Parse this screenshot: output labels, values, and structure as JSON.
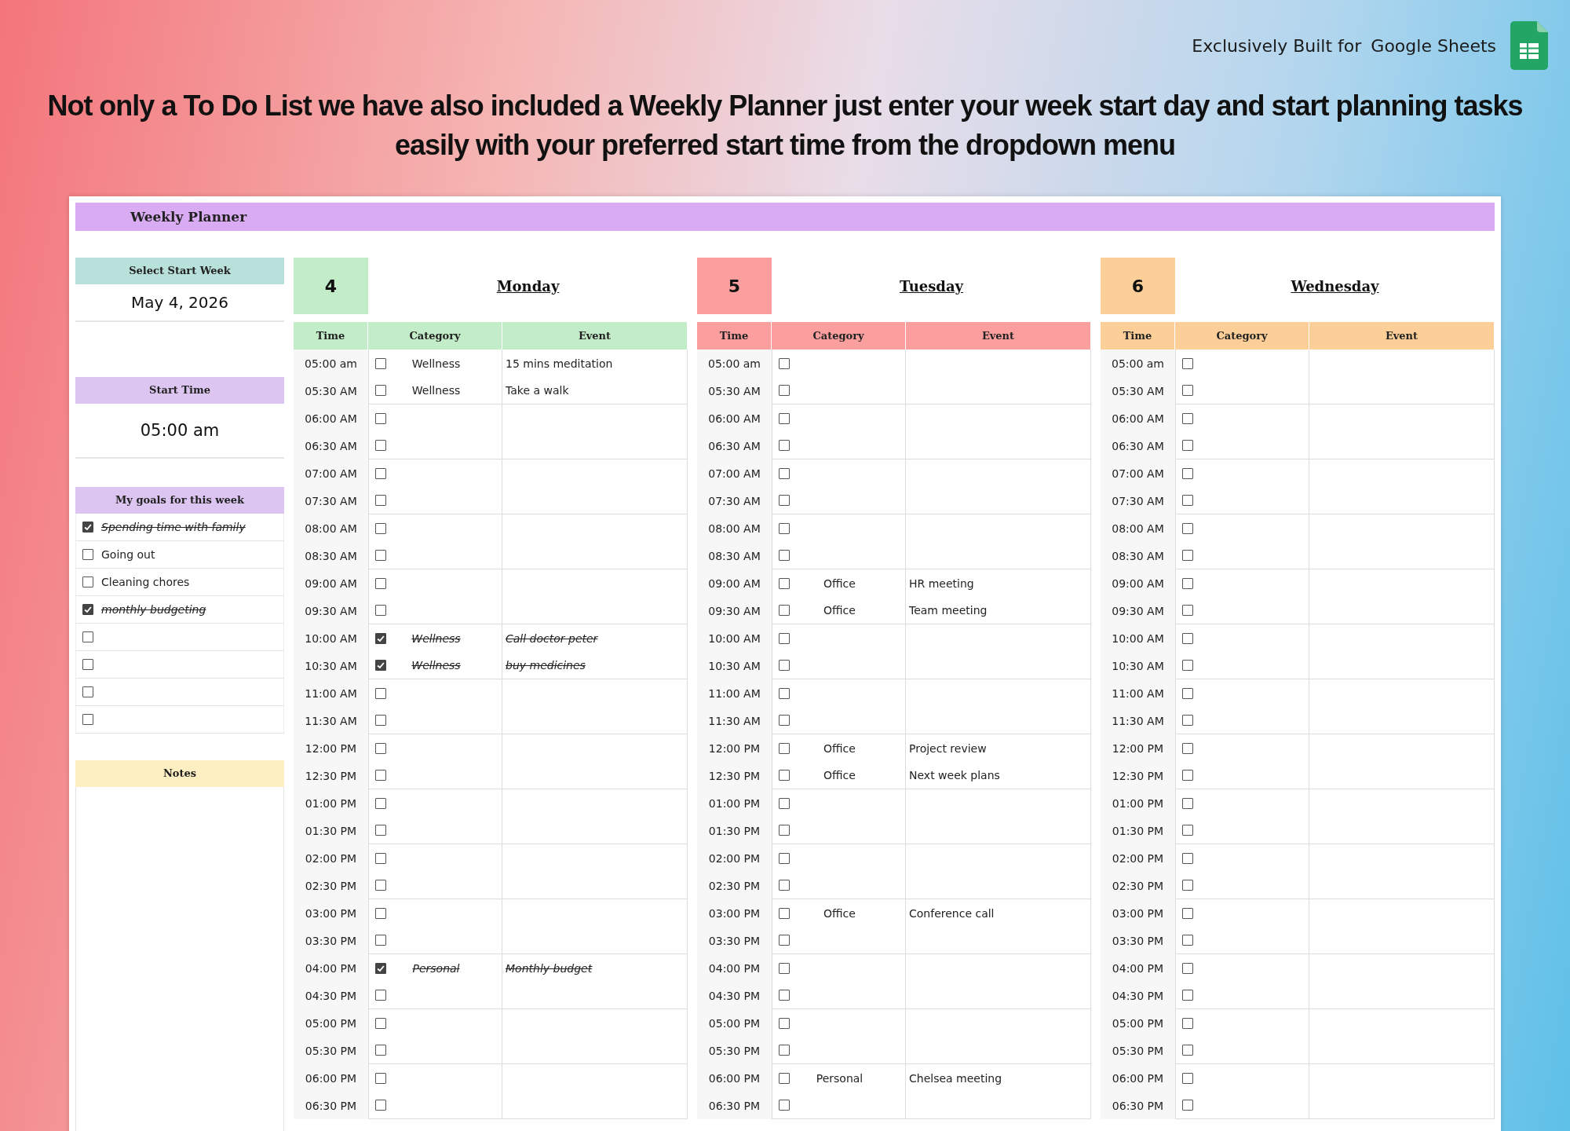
{
  "promo": {
    "built_for": "Exclusively Built for",
    "brand": "Google Sheets",
    "headline": "Not only a To Do List we have also included a Weekly Planner just enter your week start day and start planning tasks easily with your preferred start time from the dropdown menu"
  },
  "sheet": {
    "title": "Weekly Planner",
    "sidebar": {
      "start_week": {
        "label": "Select Start Week",
        "value": "May 4, 2026"
      },
      "start_time": {
        "label": "Start Time",
        "value": "05:00 am"
      },
      "goals": {
        "label": "My goals for this week",
        "items": [
          {
            "text": "Spending time with family",
            "checked": true
          },
          {
            "text": "Going out",
            "checked": false
          },
          {
            "text": "Cleaning chores",
            "checked": false
          },
          {
            "text": "monthly budgeting",
            "checked": true
          },
          {
            "checked": false
          },
          {
            "checked": false
          },
          {
            "checked": false
          },
          {
            "checked": false
          }
        ]
      },
      "notes": {
        "label": "Notes"
      }
    },
    "days": [
      {
        "date": "4",
        "name": "Monday",
        "color": "#c3ecc8",
        "columns": [
          "Time",
          "Category",
          "Event"
        ],
        "slots": [
          {
            "time": "05:00 am",
            "checked": false,
            "category": "Wellness",
            "event": "15 mins meditation"
          },
          {
            "time": "05:30 AM",
            "checked": false,
            "category": "Wellness",
            "event": "Take a walk"
          },
          {
            "time": "06:00 AM",
            "checked": false
          },
          {
            "time": "06:30 AM",
            "checked": false
          },
          {
            "time": "07:00 AM",
            "checked": false
          },
          {
            "time": "07:30 AM",
            "checked": false
          },
          {
            "time": "08:00 AM",
            "checked": false
          },
          {
            "time": "08:30 AM",
            "checked": false
          },
          {
            "time": "09:00 AM",
            "checked": false
          },
          {
            "time": "09:30 AM",
            "checked": false
          },
          {
            "time": "10:00 AM",
            "checked": true,
            "category": "Wellness",
            "event": "Call doctor peter"
          },
          {
            "time": "10:30 AM",
            "checked": true,
            "category": "Wellness",
            "event": "buy medicines"
          },
          {
            "time": "11:00 AM",
            "checked": false
          },
          {
            "time": "11:30 AM",
            "checked": false
          },
          {
            "time": "12:00 PM",
            "checked": false
          },
          {
            "time": "12:30 PM",
            "checked": false
          },
          {
            "time": "01:00 PM",
            "checked": false
          },
          {
            "time": "01:30 PM",
            "checked": false
          },
          {
            "time": "02:00 PM",
            "checked": false
          },
          {
            "time": "02:30 PM",
            "checked": false
          },
          {
            "time": "03:00 PM",
            "checked": false
          },
          {
            "time": "03:30 PM",
            "checked": false
          },
          {
            "time": "04:00 PM",
            "checked": true,
            "category": "Personal",
            "event": "Monthly budget"
          },
          {
            "time": "04:30 PM",
            "checked": false
          },
          {
            "time": "05:00 PM",
            "checked": false
          },
          {
            "time": "05:30 PM",
            "checked": false
          },
          {
            "time": "06:00 PM",
            "checked": false
          },
          {
            "time": "06:30 PM",
            "checked": false
          }
        ]
      },
      {
        "date": "5",
        "name": "Tuesday",
        "color": "#fa9e9e",
        "columns": [
          "Time",
          "Category",
          "Event"
        ],
        "slots": [
          {
            "time": "05:00 am",
            "checked": false
          },
          {
            "time": "05:30 AM",
            "checked": false
          },
          {
            "time": "06:00 AM",
            "checked": false
          },
          {
            "time": "06:30 AM",
            "checked": false
          },
          {
            "time": "07:00 AM",
            "checked": false
          },
          {
            "time": "07:30 AM",
            "checked": false
          },
          {
            "time": "08:00 AM",
            "checked": false
          },
          {
            "time": "08:30 AM",
            "checked": false
          },
          {
            "time": "09:00 AM",
            "checked": false,
            "category": "Office",
            "event": "HR meeting"
          },
          {
            "time": "09:30 AM",
            "checked": false,
            "category": "Office",
            "event": "Team meeting"
          },
          {
            "time": "10:00 AM",
            "checked": false
          },
          {
            "time": "10:30 AM",
            "checked": false
          },
          {
            "time": "11:00 AM",
            "checked": false
          },
          {
            "time": "11:30 AM",
            "checked": false
          },
          {
            "time": "12:00 PM",
            "checked": false,
            "category": "Office",
            "event": "Project review"
          },
          {
            "time": "12:30 PM",
            "checked": false,
            "category": "Office",
            "event": "Next week plans"
          },
          {
            "time": "01:00 PM",
            "checked": false
          },
          {
            "time": "01:30 PM",
            "checked": false
          },
          {
            "time": "02:00 PM",
            "checked": false
          },
          {
            "time": "02:30 PM",
            "checked": false
          },
          {
            "time": "03:00 PM",
            "checked": false,
            "category": "Office",
            "event": "Conference call"
          },
          {
            "time": "03:30 PM",
            "checked": false
          },
          {
            "time": "04:00 PM",
            "checked": false
          },
          {
            "time": "04:30 PM",
            "checked": false
          },
          {
            "time": "05:00 PM",
            "checked": false
          },
          {
            "time": "05:30 PM",
            "checked": false
          },
          {
            "time": "06:00 PM",
            "checked": false,
            "category": "Personal",
            "event": "Chelsea meeting"
          },
          {
            "time": "06:30 PM",
            "checked": false
          }
        ]
      },
      {
        "date": "6",
        "name": "Wednesday",
        "color": "#fbcf97",
        "columns": [
          "Time",
          "Category",
          "Event"
        ],
        "slots": [
          {
            "time": "05:00 am",
            "checked": false
          },
          {
            "time": "05:30 AM",
            "checked": false
          },
          {
            "time": "06:00 AM",
            "checked": false
          },
          {
            "time": "06:30 AM",
            "checked": false
          },
          {
            "time": "07:00 AM",
            "checked": false
          },
          {
            "time": "07:30 AM",
            "checked": false
          },
          {
            "time": "08:00 AM",
            "checked": false
          },
          {
            "time": "08:30 AM",
            "checked": false
          },
          {
            "time": "09:00 AM",
            "checked": false
          },
          {
            "time": "09:30 AM",
            "checked": false
          },
          {
            "time": "10:00 AM",
            "checked": false
          },
          {
            "time": "10:30 AM",
            "checked": false
          },
          {
            "time": "11:00 AM",
            "checked": false
          },
          {
            "time": "11:30 AM",
            "checked": false
          },
          {
            "time": "12:00 PM",
            "checked": false
          },
          {
            "time": "12:30 PM",
            "checked": false
          },
          {
            "time": "01:00 PM",
            "checked": false
          },
          {
            "time": "01:30 PM",
            "checked": false
          },
          {
            "time": "02:00 PM",
            "checked": false
          },
          {
            "time": "02:30 PM",
            "checked": false
          },
          {
            "time": "03:00 PM",
            "checked": false
          },
          {
            "time": "03:30 PM",
            "checked": false
          },
          {
            "time": "04:00 PM",
            "checked": false
          },
          {
            "time": "04:30 PM",
            "checked": false
          },
          {
            "time": "05:00 PM",
            "checked": false
          },
          {
            "time": "05:30 PM",
            "checked": false
          },
          {
            "time": "06:00 PM",
            "checked": false
          },
          {
            "time": "06:30 PM",
            "checked": false
          }
        ]
      }
    ]
  }
}
